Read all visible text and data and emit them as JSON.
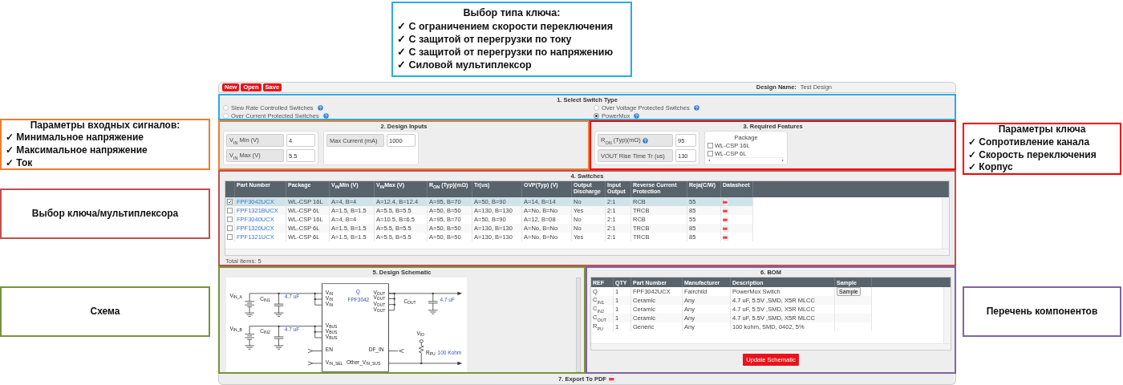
{
  "callout_top": {
    "title": "Выбор типа ключа:",
    "color": "#29abe2",
    "items": [
      "✓ С ограничением скорости переключения",
      "✓ С защитой от перегрузки по току",
      "✓ С защитой от перегрузки по напряжению",
      "✓ Силовой мультиплексор"
    ]
  },
  "callouts_left": [
    {
      "title": "Параметры входных сигналов:",
      "color": "#ed7d31",
      "items": [
        "✓ Минимальное напряжение",
        "✓ Максимальное напряжение",
        "✓ Ток"
      ]
    },
    {
      "title": "Выбор ключа/мультиплексора",
      "color": "#c0504d"
    },
    {
      "title": "Схема",
      "color": "#77933c"
    }
  ],
  "callouts_right": [
    {
      "title": "Параметры ключа",
      "color": "#ff0000",
      "items": [
        "✓ Сопротивление канала",
        "✓ Скорость переключения",
        "✓ Корпус"
      ]
    },
    {
      "title": "Перечень компонентов",
      "color": "#8064a2"
    }
  ],
  "toolbar": {
    "buttons": [
      "New",
      "Open",
      "Save"
    ],
    "design_name_label": "Design Name:",
    "design_name": "Test Design"
  },
  "switch_type": {
    "title": "1. Select Switch Type",
    "color": "#29abe2",
    "options": [
      {
        "label": "Slew Rate Controlled Switches",
        "selected": false
      },
      {
        "label": "Over Voltage Protected Switches",
        "selected": false
      },
      {
        "label": "Over Current Protected Switches",
        "selected": false
      },
      {
        "label": "PowerMux",
        "selected": true
      }
    ]
  },
  "design_inputs": {
    "title": "2. Design Inputs",
    "color": "#ed7d31",
    "groups": [
      {
        "fields": [
          {
            "label": "V$_{IN}$ Min (V)",
            "value": "4"
          },
          {
            "label": "V$_{IN}$ Max (V)",
            "value": "5.5"
          }
        ]
      },
      {
        "fields": [
          {
            "label": "Max Current (mA)",
            "value": "1000"
          }
        ]
      }
    ]
  },
  "required_features": {
    "title": "3. Required Features",
    "color": "#ff0000",
    "fields": [
      {
        "label": "R$_{ON}$ (Typ)(mΩ)",
        "value": "95",
        "help": true
      },
      {
        "label": "VOUT Rise Time Tr (us)",
        "value": "130",
        "help": false
      }
    ],
    "package": {
      "title": "Package",
      "options": [
        {
          "label": "WL-CSP 16L",
          "checked": false
        },
        {
          "label": "WL-CSP 6L",
          "checked": false
        }
      ]
    }
  },
  "switches": {
    "title": "4. Switches",
    "color": "#c0504d",
    "columns": [
      "Part Number",
      "Package",
      "V$_{IN}$Min (V)",
      "V$_{IN}$Max (V)",
      "R$_{ON}$ (Typ)(mΩ)",
      "Tr(us)",
      "OVP(Typ) (V)",
      "Output Discharge",
      "Input Output",
      "Reverse Current Protection",
      "Reja(C/W)",
      "Datasheet"
    ],
    "rows": [
      {
        "selected": true,
        "cells": [
          "FPF3042UCX",
          "WL-CSP 16L",
          "A=4, B=4",
          "A=12.4, B=12.4",
          "A=95, B=70",
          "A=50, B=90",
          "A=14, B=14",
          "No",
          "2:1",
          "RCB",
          "55"
        ]
      },
      {
        "selected": false,
        "cells": [
          "FPF1321BUCX",
          "WL-CSP 6L",
          "A=1.5, B=1.5",
          "A=5.5, B=5.5",
          "A=50, B=50",
          "A=130, B=130",
          "A=No, B=No",
          "Yes",
          "2:1",
          "TRCB",
          "85"
        ]
      },
      {
        "selected": false,
        "cells": [
          "FPF3040UCX",
          "WL-CSP 16L",
          "A=4, B=4",
          "A=10.5, B=6.5",
          "A=95, B=70",
          "A=50, B=90",
          "A=12, B=08",
          "No",
          "2:1",
          "RCB",
          "55"
        ]
      },
      {
        "selected": false,
        "cells": [
          "FPF1320UCX",
          "WL-CSP 6L",
          "A=1.5, B=1.5",
          "A=5.5, B=5.5",
          "A=50, B=50",
          "A=130, B=130",
          "A=No, B=No",
          "No",
          "2:1",
          "TRCB",
          "85"
        ]
      },
      {
        "selected": false,
        "cells": [
          "FPF1321UCX",
          "WL-CSP 6L",
          "A=1.5, B=1.5",
          "A=5.5, B=5.5",
          "A=50, B=50",
          "A=130, B=130",
          "A=No, B=No",
          "Yes",
          "2:1",
          "TRCB",
          "85"
        ]
      }
    ],
    "total": "Total Items: 5"
  },
  "schematic": {
    "title": "5. Design Schematic",
    "color": "#77933c",
    "labels": [
      {
        "text": "V$_{IN_A}$",
        "kind": "pin"
      },
      {
        "text": "C$_{IN1}$",
        "kind": "pin"
      },
      {
        "text": "4.7 uF",
        "kind": "value"
      },
      {
        "text": "V$_{IN_B}$",
        "kind": "pin"
      },
      {
        "text": "C$_{IN2}$",
        "kind": "pin"
      },
      {
        "text": "4.7 uF",
        "kind": "value"
      },
      {
        "text": "V$_{IN}$",
        "kind": "pin"
      },
      {
        "text": "V$_{IN}$",
        "kind": "pin"
      },
      {
        "text": "V$_{IN}$",
        "kind": "pin"
      },
      {
        "text": "V$_{BUS}$",
        "kind": "pin"
      },
      {
        "text": "V$_{BUS}$",
        "kind": "pin"
      },
      {
        "text": "V$_{BUS}$",
        "kind": "pin"
      },
      {
        "text": "EN",
        "kind": "pin"
      },
      {
        "text": "V$_{IN_SEL}$",
        "kind": "pin"
      },
      {
        "text": "Q",
        "kind": "value"
      },
      {
        "text": "FPF3042",
        "kind": "value"
      },
      {
        "text": "V$_{OUT}$",
        "kind": "pin"
      },
      {
        "text": "V$_{OUT}$",
        "kind": "pin"
      },
      {
        "text": "V$_{OUT}$",
        "kind": "pin"
      },
      {
        "text": "V$_{OUT}$",
        "kind": "pin"
      },
      {
        "text": "C$_{OUT}$",
        "kind": "pin"
      },
      {
        "text": "4.7 uF",
        "kind": "value"
      },
      {
        "text": "V$_{IO}$",
        "kind": "pin"
      },
      {
        "text": "DF_IN",
        "kind": "pin"
      },
      {
        "text": "R$_{PU}$",
        "kind": "pin"
      },
      {
        "text": "100 Kohm",
        "kind": "value"
      },
      {
        "text": "Other_V$_{IN_SUS}$",
        "kind": "pin"
      }
    ]
  },
  "bom": {
    "title": "6. BOM",
    "color": "#8064a2",
    "columns": [
      "REF",
      "QTY",
      "Part Number",
      "Manufacturer",
      "Description",
      "Sample"
    ],
    "rows": [
      {
        "cells": [
          "Q",
          "1",
          "FPF3042UCX",
          "Fairchild",
          "PowerMux Switch"
        ],
        "sample": "Sample"
      },
      {
        "cells": [
          "C$_{IN1}$",
          "1",
          "Ceramic",
          "Any",
          "4.7 uF, 5.5V ,SMD, X5R MLCC"
        ]
      },
      {
        "cells": [
          "C$_{IN2}$",
          "1",
          "Ceramic",
          "Any",
          "4.7 uF, 5.5V ,SMD, X5R MLCC"
        ]
      },
      {
        "cells": [
          "C$_{OUT}$",
          "1",
          "Ceramic",
          "Any",
          "4.7 uF, 5.5V ,SMD, X5R MLCC"
        ]
      },
      {
        "cells": [
          "R$_{PU}$",
          "1",
          "Generic",
          "Any",
          "100 kohm, SMD, 0402, 5%"
        ]
      }
    ],
    "update_button": "Update Schematic"
  },
  "export": {
    "label": "7. Export To PDF"
  }
}
